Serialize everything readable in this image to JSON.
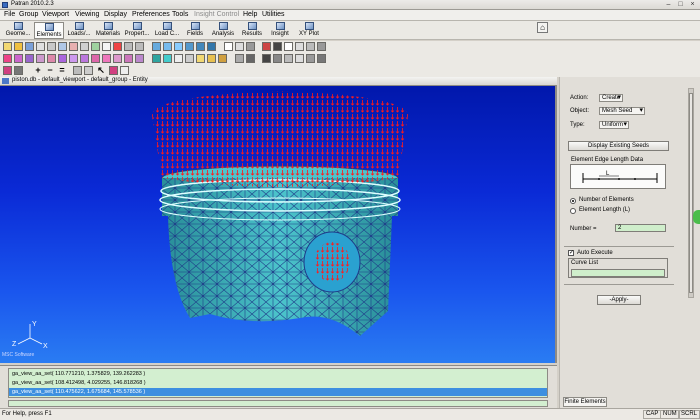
{
  "window": {
    "title": "Patran 2010.2.3"
  },
  "menu": [
    "File",
    "Group",
    "Viewport",
    "Viewing",
    "Display",
    "Preferences",
    "Tools",
    "Insight Control",
    "Help",
    "Utilities"
  ],
  "menu_disabled": [
    "Insight Control"
  ],
  "app_buttons": [
    "Geome...",
    "Elements",
    "Loads/...",
    "Materials",
    "Propert...",
    "Load C...",
    "Fields",
    "Analysis",
    "Results",
    "Insight",
    "XY Plot"
  ],
  "active_app": "Elements",
  "viewport": {
    "title": "piston.db - default_viewport - default_group - Entity",
    "triad_label": "MSC Software",
    "axis_labels": [
      "Y",
      "Z",
      "X"
    ]
  },
  "panel": {
    "action_label": "Action:",
    "action_value": "Create",
    "object_label": "Object:",
    "object_value": "Mesh Seed",
    "type_label": "Type:",
    "type_value": "Uniform",
    "display_existing_seeds": "Display Existing Seeds",
    "group_title": "Element Edge Length Data",
    "diagram_label": "L",
    "radio_number_of_elements": "Number of Elements",
    "radio_element_length": "Element Length (L)",
    "number_label": "Number =",
    "number_value": "2",
    "auto_execute": "Auto Execute",
    "curve_list_label": "Curve List",
    "curve_list_value": "",
    "apply_button": "-Apply-",
    "tab_label": "Finite Elements"
  },
  "history": [
    "ga_view_aa_set( 110.771210, 1.375829, 139.262283 )",
    "ga_view_aa_set( 108.412498, 4.029255, 146.818268 )",
    "ga_view_aa_set( 110.475622, 1.675684, 145.578536 )"
  ],
  "history_selected": 2,
  "status": {
    "help": "For Help, press F1",
    "indicators": [
      "CAP",
      "NUM",
      "SCRL"
    ]
  },
  "colors": {
    "viewport_top": "#0016a8",
    "viewport_bottom": "#2a7cf2",
    "mesh_fill": "#3fb6bf",
    "mesh_edge": "#1e3a88",
    "seed_color": "#ff1a1a",
    "selection": "#3d8fe0"
  }
}
